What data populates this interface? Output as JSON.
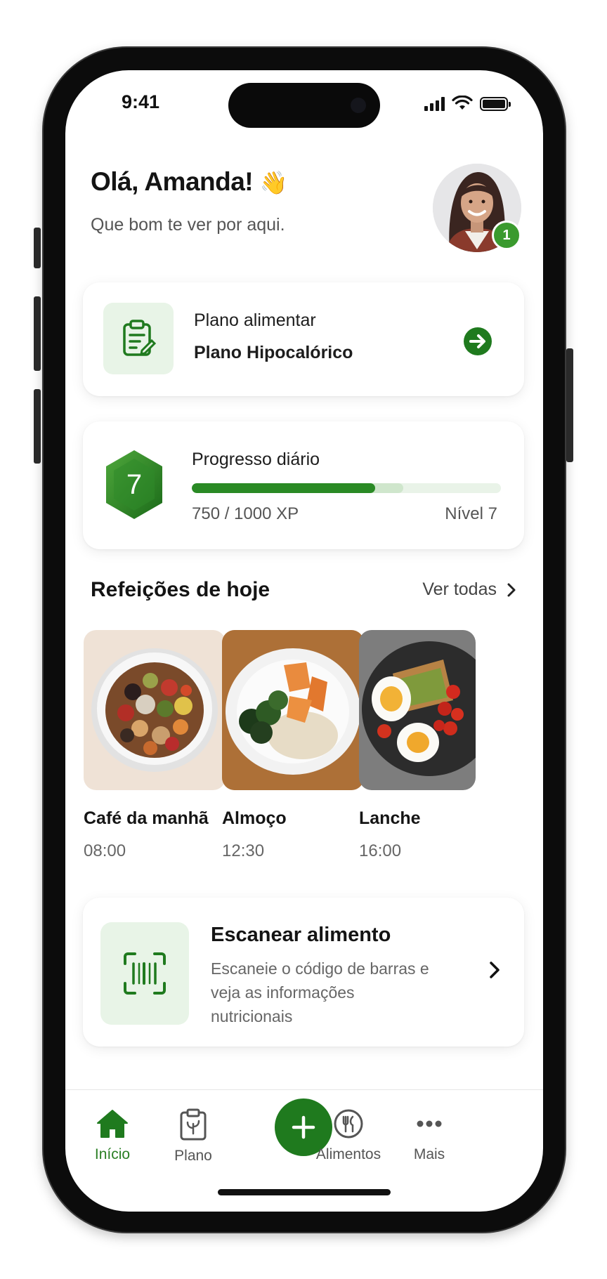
{
  "status": {
    "time": "9:41"
  },
  "header": {
    "greeting": "Olá, Amanda!",
    "wave": "👋",
    "subtitle": "Que bom te ver por aqui.",
    "notification_count": "1"
  },
  "plan_card": {
    "label": "Plano alimentar",
    "name": "Plano Hipocalórico",
    "icon": "clipboard-icon"
  },
  "progress_card": {
    "level_badge": "7",
    "title": "Progresso diário",
    "xp_text": "750 / 1000 XP",
    "level_text": "Nível 7",
    "progress_fraction": 0.594
  },
  "meals_section": {
    "title": "Refeições de hoje",
    "see_all": "Ver todas",
    "meals": [
      {
        "name": "Café da manhã",
        "time": "08:00"
      },
      {
        "name": "Almoço",
        "time": "12:30"
      },
      {
        "name": "Lanche",
        "time": "16:00"
      }
    ]
  },
  "scan_card": {
    "title": "Escanear alimento",
    "description": "Escaneie o código de barras e veja as informações nutricionais",
    "icon": "barcode-scan-icon"
  },
  "bottom_nav": {
    "items": [
      {
        "label": "Início",
        "icon": "home-icon",
        "active": true
      },
      {
        "label": "Plano",
        "icon": "clipboard-icon",
        "active": false
      },
      {
        "label": "",
        "icon": "plus-icon",
        "active": false
      },
      {
        "label": "Alimentos",
        "icon": "fork-knife-icon",
        "active": false
      },
      {
        "label": "Mais",
        "icon": "more-dots-icon",
        "active": false
      }
    ]
  },
  "colors": {
    "accent": "#1f7a1e",
    "accent_light": "#e8f4e7",
    "progress_track": "#e9f3e8"
  }
}
